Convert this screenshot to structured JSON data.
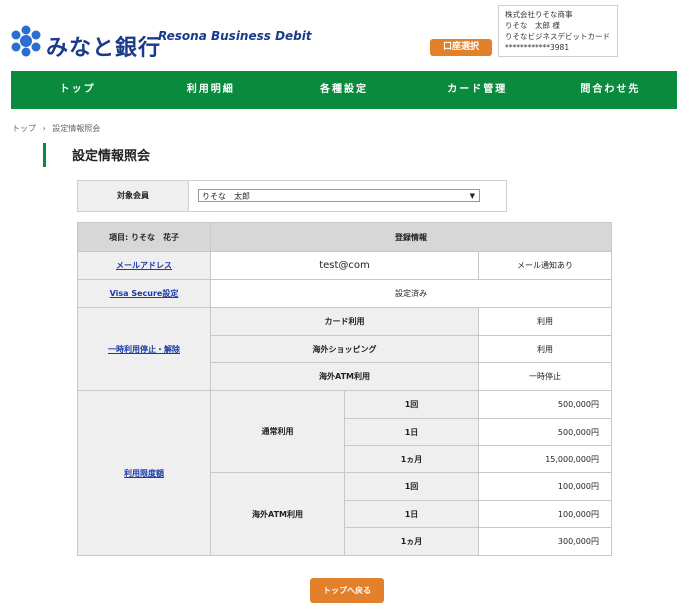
{
  "header": {
    "bank_name": "みなと銀行",
    "product_name": "Resona Business Debit",
    "account_select_button": "口座選択",
    "user_info": {
      "company": "株式会社りそな商事",
      "user": "りそな　太郎 様",
      "card": "りそなビジネスデビットカード",
      "card_number": "************3981"
    }
  },
  "nav": {
    "items": [
      "トップ",
      "利用明細",
      "各種設定",
      "カード管理",
      "問合わせ先"
    ]
  },
  "breadcrumb": {
    "home": "トップ",
    "sep": "›",
    "current": "設定情報照会"
  },
  "page_title": "設定情報照会",
  "member": {
    "label": "対象会員",
    "selected": "りそな　太郎",
    "arrow": "▼"
  },
  "table": {
    "item_header": "項目: りそな　花子",
    "registered_header": "登録情報",
    "email": {
      "label": "メールアドレス",
      "value": "test@com",
      "notice": "メール通知あり"
    },
    "visa": {
      "label": "Visa Secure設定",
      "value": "設定済み"
    },
    "suspend": {
      "label": "一時利用停止・解除",
      "rows": [
        {
          "name": "カード利用",
          "value": "利用"
        },
        {
          "name": "海外ショッピング",
          "value": "利用"
        },
        {
          "name": "海外ATM利用",
          "value": "一時停止"
        }
      ]
    },
    "limits": {
      "label": "利用限度額",
      "groups": [
        {
          "name": "通常利用",
          "rows": [
            {
              "period": "1回",
              "amount": "500,000円"
            },
            {
              "period": "1日",
              "amount": "500,000円"
            },
            {
              "period": "1ヵ月",
              "amount": "15,000,000円"
            }
          ]
        },
        {
          "name": "海外ATM利用",
          "rows": [
            {
              "period": "1回",
              "amount": "100,000円"
            },
            {
              "period": "1日",
              "amount": "100,000円"
            },
            {
              "period": "1ヵ月",
              "amount": "300,000円"
            }
          ]
        }
      ]
    }
  },
  "back_button": "トップへ戻る"
}
